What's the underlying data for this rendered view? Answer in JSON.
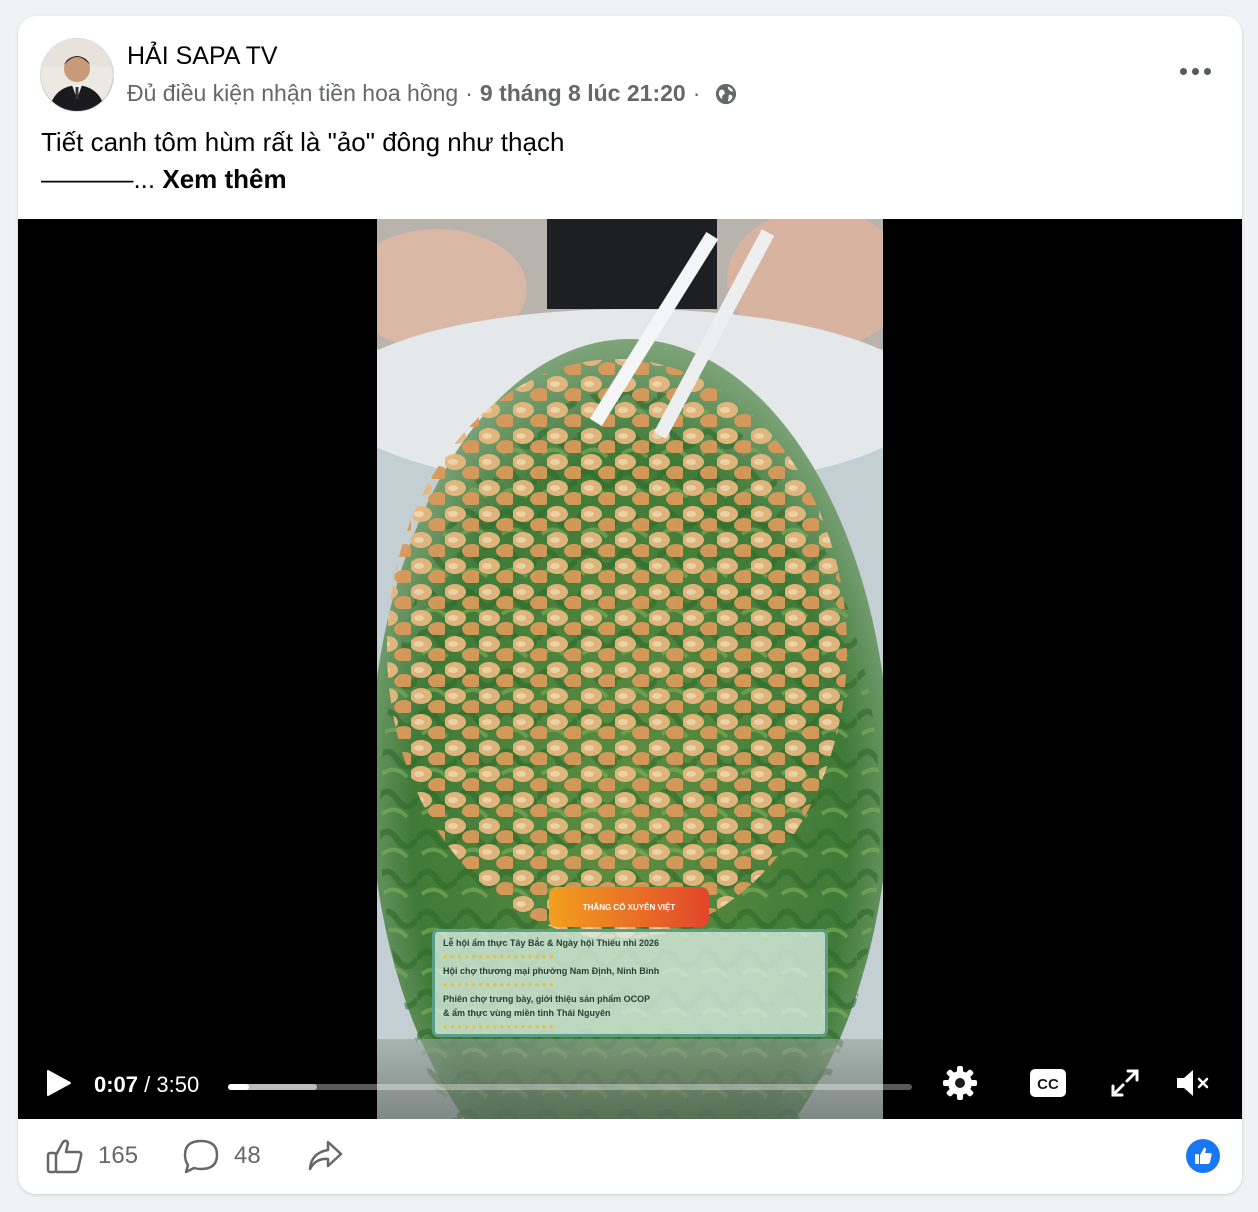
{
  "post": {
    "author": "HẢI SAPA TV",
    "meta_status": "Đủ điều kiện nhận tiền hoa hồng",
    "separator": "·",
    "timestamp": "9 tháng 8 lúc 21:20",
    "caption_line1": "Tiết canh tôm hùm rất là \"ảo\" đông như thạch",
    "caption_line2_prefix": "———–...",
    "see_more": "Xem thêm"
  },
  "video": {
    "current_time": "0:07",
    "total_time": "/ 3:50",
    "progress_fraction": 0.03,
    "buffered_fraction": 0.13,
    "overlay_badge": "THẮNG CỐ XUYÊN VIỆT",
    "overlay_events": [
      {
        "title": "Lễ hội ẩm thực Tây Bắc & Ngày hội Thiếu nhi 2026"
      },
      {
        "title": "Hội chợ thương mại phường Nam Định, Ninh Bình"
      },
      {
        "title": "Phiên chợ trưng bày, giới thiệu sản phẩm OCOP"
      },
      {
        "title": "& ẩm thực vùng miền tỉnh Thái Nguyên"
      }
    ]
  },
  "actions": {
    "likes": "165",
    "comments": "48"
  },
  "icons": {
    "globe": "globe-icon",
    "more": "more-icon",
    "play": "play-icon",
    "settings": "gear-icon",
    "captions": "cc-icon",
    "fullscreen": "fullscreen-icon",
    "mute": "muted-speaker-icon",
    "like": "thumbs-up-icon",
    "comment": "comment-icon",
    "share": "share-icon"
  },
  "colors": {
    "accent": "#1877f2",
    "secondary_text": "#65676b"
  }
}
